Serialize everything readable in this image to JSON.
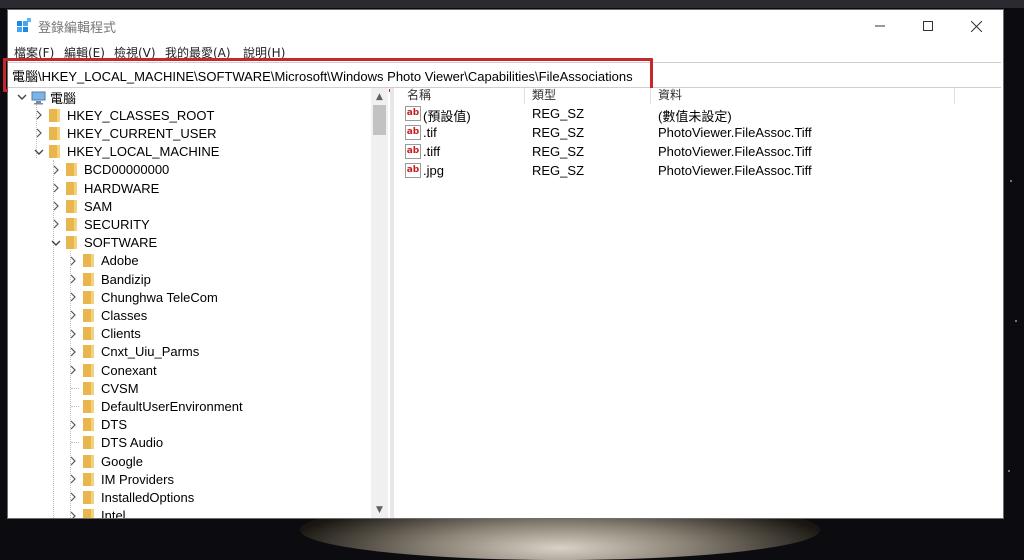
{
  "window": {
    "title": "登錄編輯程式"
  },
  "menu": [
    "檔案(F)",
    "編輯(E)",
    "檢視(V)",
    "我的最愛(A)",
    "說明(H)"
  ],
  "address": {
    "path": "電腦\\HKEY_LOCAL_MACHINE\\SOFTWARE\\Microsoft\\Windows Photo Viewer\\Capabilities\\FileAssociations"
  },
  "tree": [
    {
      "label": "電腦",
      "icon": "computer-icon",
      "expanded": true
    },
    {
      "label": "HKEY_CLASSES_ROOT",
      "expanded": false
    },
    {
      "label": "HKEY_CURRENT_USER",
      "expanded": false
    },
    {
      "label": "HKEY_LOCAL_MACHINE",
      "expanded": true
    },
    {
      "label": "BCD00000000",
      "expanded": false
    },
    {
      "label": "HARDWARE",
      "expanded": false
    },
    {
      "label": "SAM",
      "expanded": false
    },
    {
      "label": "SECURITY",
      "expanded": false
    },
    {
      "label": "SOFTWARE",
      "expanded": true
    },
    {
      "label": "Adobe",
      "expanded": false
    },
    {
      "label": "Bandizip",
      "expanded": false
    },
    {
      "label": "Chunghwa TeleCom",
      "expanded": false
    },
    {
      "label": "Classes",
      "expanded": false
    },
    {
      "label": "Clients",
      "expanded": false
    },
    {
      "label": "Cnxt_Uiu_Parms",
      "expanded": false
    },
    {
      "label": "Conexant",
      "expanded": false
    },
    {
      "label": "CVSM",
      "leaf": true
    },
    {
      "label": "DefaultUserEnvironment",
      "leaf": true
    },
    {
      "label": "DTS",
      "expanded": false
    },
    {
      "label": "DTS Audio",
      "leaf": true
    },
    {
      "label": "Google",
      "expanded": false
    },
    {
      "label": "IM Providers",
      "expanded": false
    },
    {
      "label": "InstalledOptions",
      "expanded": false
    },
    {
      "label": "Intel",
      "expanded": false
    }
  ],
  "list": {
    "columns": [
      "名稱",
      "類型",
      "資料"
    ],
    "rows": [
      {
        "name": "(預設值)",
        "type": "REG_SZ",
        "data": "(數值未設定)"
      },
      {
        "name": ".tif",
        "type": "REG_SZ",
        "data": "PhotoViewer.FileAssoc.Tiff"
      },
      {
        "name": ".tiff",
        "type": "REG_SZ",
        "data": "PhotoViewer.FileAssoc.Tiff"
      },
      {
        "name": ".jpg",
        "type": "REG_SZ",
        "data": "PhotoViewer.FileAssoc.Tiff"
      }
    ],
    "value_icon_text": "ab"
  },
  "colors": {
    "highlight_box": "#c8262d",
    "folder": "#e8b64c",
    "value_icon": "#c42020"
  }
}
